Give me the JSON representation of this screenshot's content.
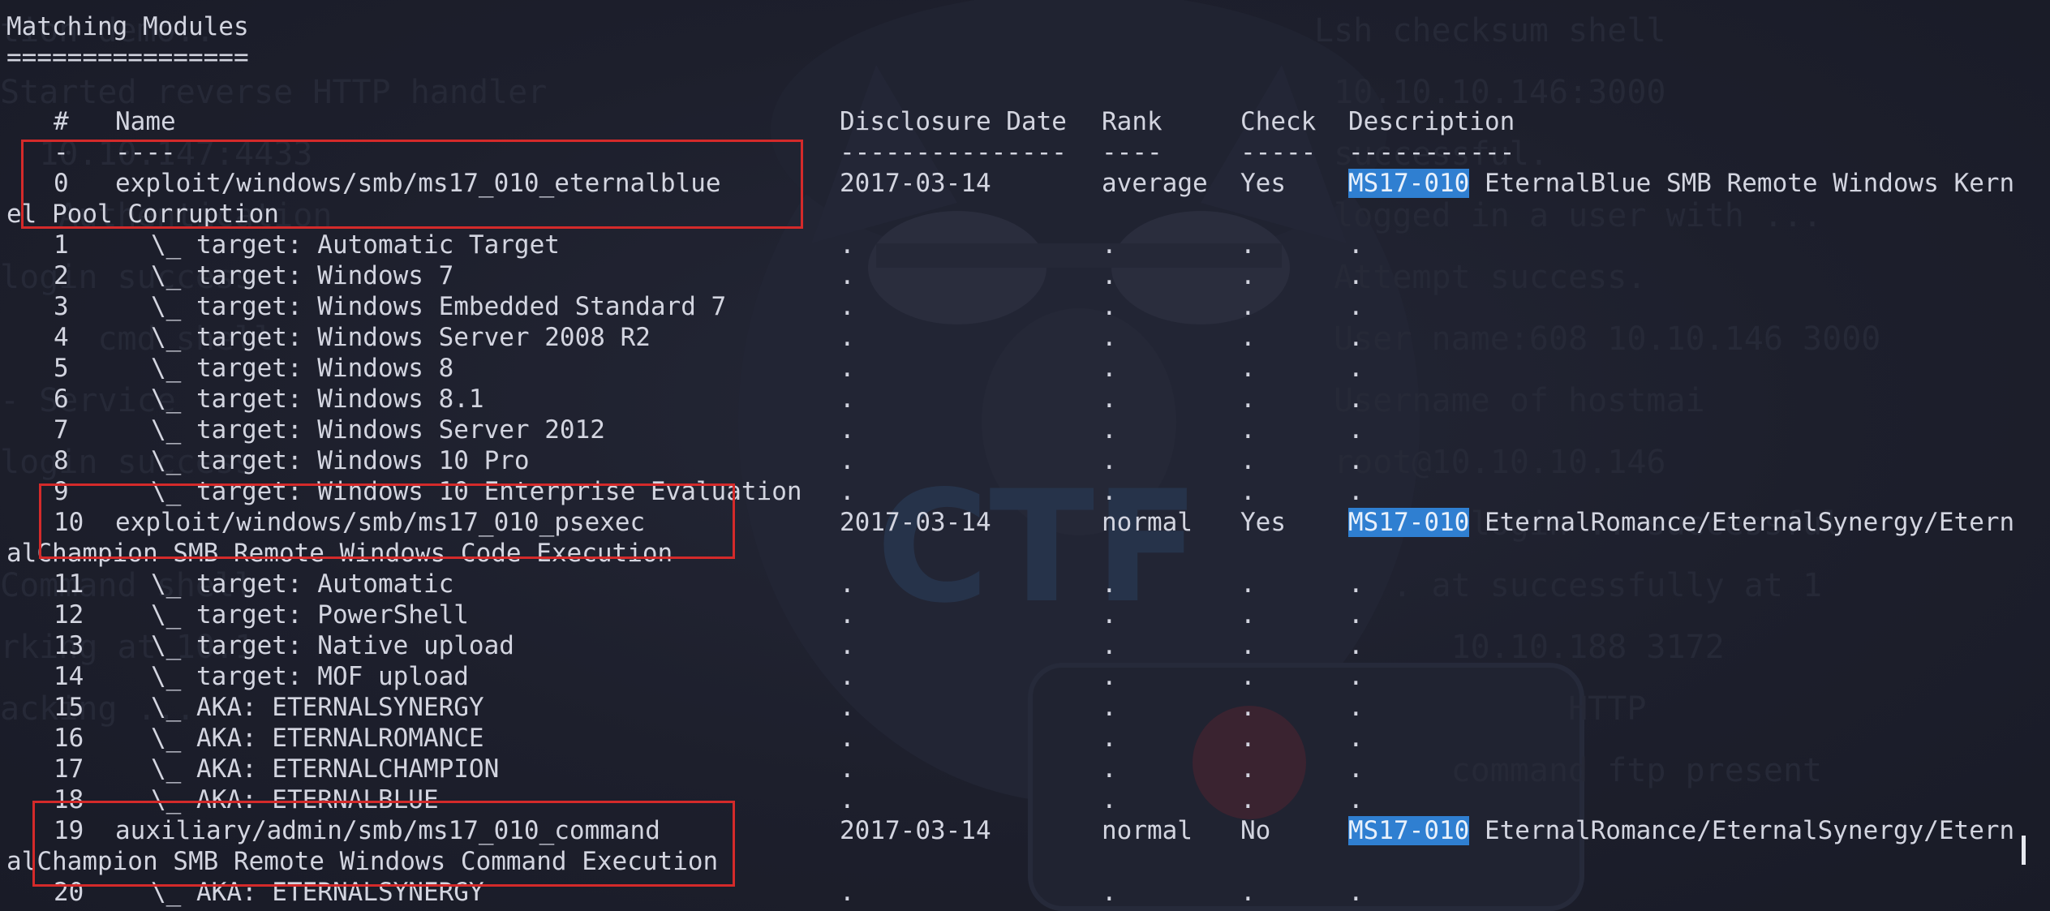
{
  "heading": {
    "title": "Matching Modules",
    "underline": "================"
  },
  "columns": {
    "num": "#",
    "name": "Name",
    "date": "Disclosure Date",
    "rank": "Rank",
    "check": "Check",
    "description": "Description"
  },
  "dividers": {
    "num": "-",
    "name": "----",
    "date": "---------------",
    "rank": "----",
    "check": "-----",
    "description": "-----------"
  },
  "highlight_text": "MS17-010",
  "modules": [
    {
      "num": "0",
      "name": "exploit/windows/smb/ms17_010_eternalblue",
      "date": "2017-03-14",
      "rank": "average",
      "check": "Yes",
      "desc_rest": " EternalBlue SMB Remote Windows Kern",
      "wrap": "el Pool Corruption"
    },
    {
      "num": "10",
      "name": "exploit/windows/smb/ms17_010_psexec",
      "date": "2017-03-14",
      "rank": "normal",
      "check": "Yes",
      "desc_rest": " EternalRomance/EternalSynergy/Etern",
      "wrap": "alChampion SMB Remote Windows Code Execution"
    },
    {
      "num": "19",
      "name": "auxiliary/admin/smb/ms17_010_command",
      "date": "2017-03-14",
      "rank": "normal",
      "check": "No",
      "desc_rest": " EternalRomance/EternalSynergy/Etern",
      "wrap": "alChampion SMB Remote Windows Command Execution"
    }
  ],
  "subrows": [
    {
      "num": "1",
      "text": "\\_ target: Automatic Target"
    },
    {
      "num": "2",
      "text": "\\_ target: Windows 7"
    },
    {
      "num": "3",
      "text": "\\_ target: Windows Embedded Standard 7"
    },
    {
      "num": "4",
      "text": "\\_ target: Windows Server 2008 R2"
    },
    {
      "num": "5",
      "text": "\\_ target: Windows 8"
    },
    {
      "num": "6",
      "text": "\\_ target: Windows 8.1"
    },
    {
      "num": "7",
      "text": "\\_ target: Windows Server 2012"
    },
    {
      "num": "8",
      "text": "\\_ target: Windows 10 Pro"
    },
    {
      "num": "9",
      "text": "\\_ target: Windows 10 Enterprise Evaluation"
    },
    {
      "num": "11",
      "text": "\\_ target: Automatic"
    },
    {
      "num": "12",
      "text": "\\_ target: PowerShell"
    },
    {
      "num": "13",
      "text": "\\_ target: Native upload"
    },
    {
      "num": "14",
      "text": "\\_ target: MOF upload"
    },
    {
      "num": "15",
      "text": "\\_ AKA: ETERNALSYNERGY"
    },
    {
      "num": "16",
      "text": "\\_ AKA: ETERNALROMANCE"
    },
    {
      "num": "17",
      "text": "\\_ AKA: ETERNALCHAMPION"
    },
    {
      "num": "18",
      "text": "\\_ AKA: ETERNALBLUE"
    },
    {
      "num": "20",
      "text": "\\_ AKA: ETERNALSYNERGY"
    }
  ],
  "dot": ".",
  "colors": {
    "background": "#1c1e2b",
    "text": "#d3d5e0",
    "highlight": "#2f7fd1",
    "annotation_box": "#d42a2a"
  }
}
